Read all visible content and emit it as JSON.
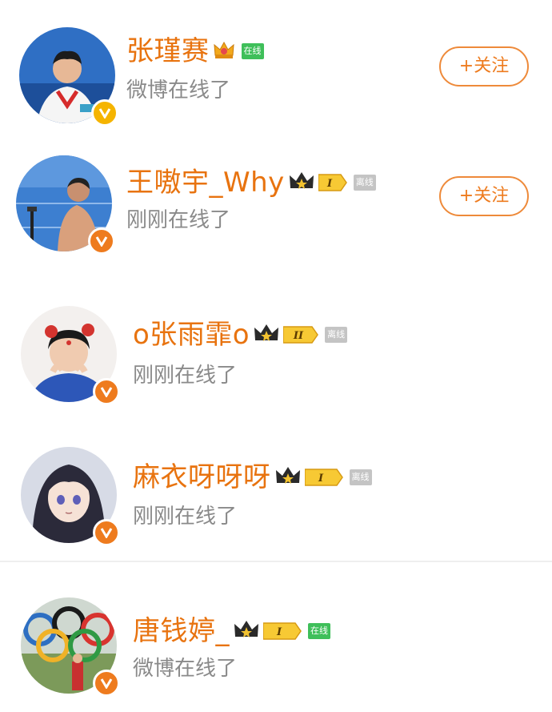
{
  "users": [
    {
      "name": "张瑾赛",
      "status": "微博在线了",
      "presence": "在线",
      "follow_label": "+关注",
      "badge_color": "#f5b400"
    },
    {
      "name": "王嗷宇_Why",
      "status": "刚刚在线了",
      "presence": "离线",
      "level": "I",
      "follow_label": "+关注",
      "badge_color": "#ee7b1e"
    },
    {
      "name": "o张雨霏o",
      "status": "刚刚在线了",
      "presence": "离线",
      "level": "II",
      "badge_color": "#ee7b1e"
    },
    {
      "name": "麻衣呀呀呀",
      "status": "刚刚在线了",
      "presence": "离线",
      "level": "I",
      "badge_color": "#ee7b1e"
    },
    {
      "name": "唐钱婷_",
      "status": "微博在线了",
      "presence": "在线",
      "level": "I",
      "badge_color": "#ee7b1e"
    }
  ],
  "colors": {
    "name": "#e8730f",
    "accent": "#ee7b1e",
    "online": "#3fbf5a",
    "offline": "#c4c4c4"
  }
}
